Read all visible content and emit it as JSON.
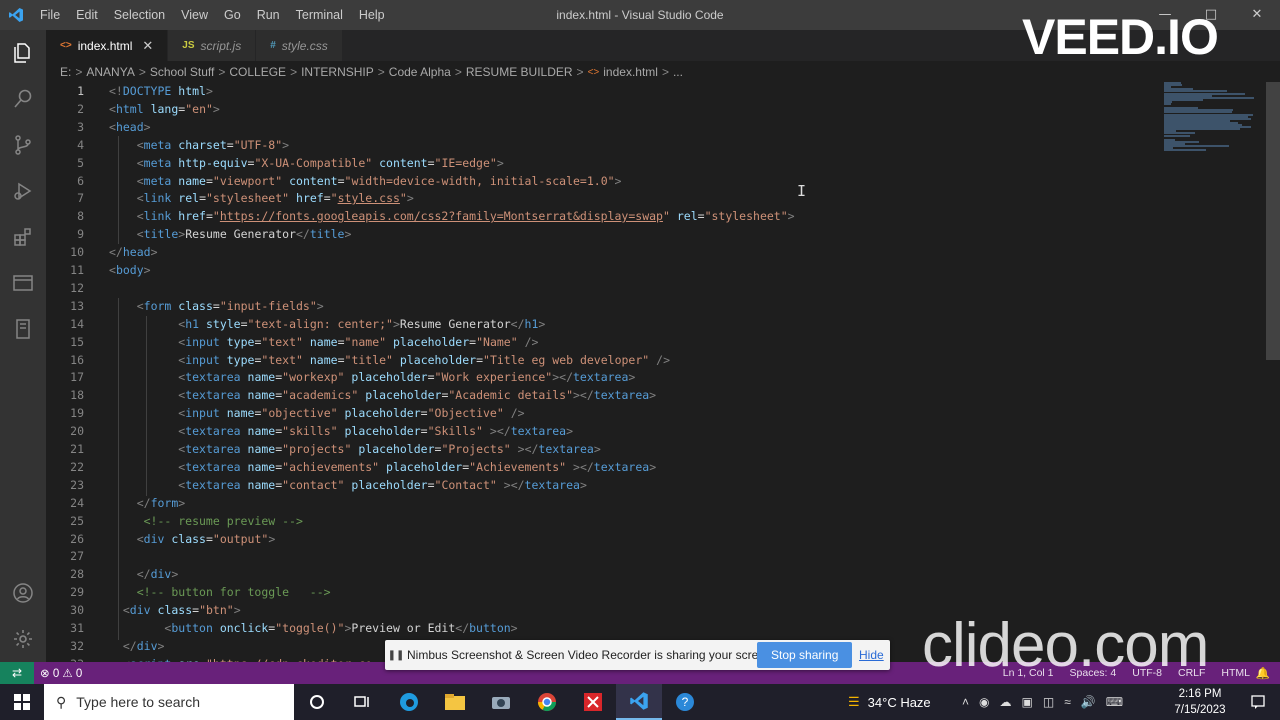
{
  "title_bar": {
    "menu": [
      "File",
      "Edit",
      "Selection",
      "View",
      "Go",
      "Run",
      "Terminal",
      "Help"
    ],
    "window_title": "index.html - Visual Studio Code"
  },
  "tabs": [
    {
      "icon": "<>",
      "label": "index.html",
      "active": true,
      "icon_color": "#e37933"
    },
    {
      "icon": "JS",
      "label": "script.js",
      "active": false,
      "icon_color": "#cbcb41"
    },
    {
      "icon": "#",
      "label": "style.css",
      "active": false,
      "icon_color": "#519aba"
    }
  ],
  "breadcrumb": [
    "E:",
    "ANANYA",
    "School Stuff",
    "COLLEGE",
    "INTERNSHIP",
    "Code Alpha",
    "RESUME BUILDER",
    "index.html",
    "..."
  ],
  "editor": {
    "current_line": 1,
    "lines": [
      [
        [
          "p",
          "<!"
        ],
        [
          "tag",
          "DOCTYPE"
        ],
        [
          "txt",
          " "
        ],
        [
          "attr",
          "html"
        ],
        [
          "p",
          ">"
        ]
      ],
      [
        [
          "p",
          "<"
        ],
        [
          "tag",
          "html"
        ],
        [
          "txt",
          " "
        ],
        [
          "attr",
          "lang"
        ],
        [
          "txt",
          "="
        ],
        [
          "str",
          "\"en\""
        ],
        [
          "p",
          ">"
        ]
      ],
      [
        [
          "p",
          "<"
        ],
        [
          "tag",
          "head"
        ],
        [
          "p",
          ">"
        ]
      ],
      [
        [
          "txt",
          "    "
        ],
        [
          "p",
          "<"
        ],
        [
          "tag",
          "meta"
        ],
        [
          "txt",
          " "
        ],
        [
          "attr",
          "charset"
        ],
        [
          "txt",
          "="
        ],
        [
          "str",
          "\"UTF-8\""
        ],
        [
          "p",
          ">"
        ]
      ],
      [
        [
          "txt",
          "    "
        ],
        [
          "p",
          "<"
        ],
        [
          "tag",
          "meta"
        ],
        [
          "txt",
          " "
        ],
        [
          "attr",
          "http-equiv"
        ],
        [
          "txt",
          "="
        ],
        [
          "str",
          "\"X-UA-Compatible\""
        ],
        [
          "txt",
          " "
        ],
        [
          "attr",
          "content"
        ],
        [
          "txt",
          "="
        ],
        [
          "str",
          "\"IE=edge\""
        ],
        [
          "p",
          ">"
        ]
      ],
      [
        [
          "txt",
          "    "
        ],
        [
          "p",
          "<"
        ],
        [
          "tag",
          "meta"
        ],
        [
          "txt",
          " "
        ],
        [
          "attr",
          "name"
        ],
        [
          "txt",
          "="
        ],
        [
          "str",
          "\"viewport\""
        ],
        [
          "txt",
          " "
        ],
        [
          "attr",
          "content"
        ],
        [
          "txt",
          "="
        ],
        [
          "str",
          "\"width=device-width, initial-scale=1.0\""
        ],
        [
          "p",
          ">"
        ]
      ],
      [
        [
          "txt",
          "    "
        ],
        [
          "p",
          "<"
        ],
        [
          "tag",
          "link"
        ],
        [
          "txt",
          " "
        ],
        [
          "attr",
          "rel"
        ],
        [
          "txt",
          "="
        ],
        [
          "str",
          "\"stylesheet\""
        ],
        [
          "txt",
          " "
        ],
        [
          "attr",
          "href"
        ],
        [
          "txt",
          "="
        ],
        [
          "str",
          "\""
        ],
        [
          "url",
          "style.css"
        ],
        [
          "str",
          "\""
        ],
        [
          "p",
          ">"
        ]
      ],
      [
        [
          "txt",
          "    "
        ],
        [
          "p",
          "<"
        ],
        [
          "tag",
          "link"
        ],
        [
          "txt",
          " "
        ],
        [
          "attr",
          "href"
        ],
        [
          "txt",
          "="
        ],
        [
          "str",
          "\""
        ],
        [
          "url",
          "https://fonts.googleapis.com/css2?family=Montserrat&display=swap"
        ],
        [
          "str",
          "\""
        ],
        [
          "txt",
          " "
        ],
        [
          "attr",
          "rel"
        ],
        [
          "txt",
          "="
        ],
        [
          "str",
          "\"stylesheet\""
        ],
        [
          "p",
          ">"
        ]
      ],
      [
        [
          "txt",
          "    "
        ],
        [
          "p",
          "<"
        ],
        [
          "tag",
          "title"
        ],
        [
          "p",
          ">"
        ],
        [
          "txt",
          "Resume Generator"
        ],
        [
          "p",
          "</"
        ],
        [
          "tag",
          "title"
        ],
        [
          "p",
          ">"
        ]
      ],
      [
        [
          "p",
          "</"
        ],
        [
          "tag",
          "head"
        ],
        [
          "p",
          ">"
        ]
      ],
      [
        [
          "p",
          "<"
        ],
        [
          "tag",
          "body"
        ],
        [
          "p",
          ">"
        ]
      ],
      [],
      [
        [
          "txt",
          "    "
        ],
        [
          "p",
          "<"
        ],
        [
          "tag",
          "form"
        ],
        [
          "txt",
          " "
        ],
        [
          "attr",
          "class"
        ],
        [
          "txt",
          "="
        ],
        [
          "str",
          "\"input-fields\""
        ],
        [
          "p",
          ">"
        ]
      ],
      [
        [
          "txt",
          "          "
        ],
        [
          "p",
          "<"
        ],
        [
          "tag",
          "h1"
        ],
        [
          "txt",
          " "
        ],
        [
          "attr",
          "style"
        ],
        [
          "txt",
          "="
        ],
        [
          "str",
          "\"text-align: center;\""
        ],
        [
          "p",
          ">"
        ],
        [
          "txt",
          "Resume Generator"
        ],
        [
          "p",
          "</"
        ],
        [
          "tag",
          "h1"
        ],
        [
          "p",
          ">"
        ]
      ],
      [
        [
          "txt",
          "          "
        ],
        [
          "p",
          "<"
        ],
        [
          "tag",
          "input"
        ],
        [
          "txt",
          " "
        ],
        [
          "attr",
          "type"
        ],
        [
          "txt",
          "="
        ],
        [
          "str",
          "\"text\""
        ],
        [
          "txt",
          " "
        ],
        [
          "attr",
          "name"
        ],
        [
          "txt",
          "="
        ],
        [
          "str",
          "\"name\""
        ],
        [
          "txt",
          " "
        ],
        [
          "attr",
          "placeholder"
        ],
        [
          "txt",
          "="
        ],
        [
          "str",
          "\"Name\""
        ],
        [
          "txt",
          " "
        ],
        [
          "p",
          "/>"
        ]
      ],
      [
        [
          "txt",
          "          "
        ],
        [
          "p",
          "<"
        ],
        [
          "tag",
          "input"
        ],
        [
          "txt",
          " "
        ],
        [
          "attr",
          "type"
        ],
        [
          "txt",
          "="
        ],
        [
          "str",
          "\"text\""
        ],
        [
          "txt",
          " "
        ],
        [
          "attr",
          "name"
        ],
        [
          "txt",
          "="
        ],
        [
          "str",
          "\"title\""
        ],
        [
          "txt",
          " "
        ],
        [
          "attr",
          "placeholder"
        ],
        [
          "txt",
          "="
        ],
        [
          "str",
          "\"Title eg web developer\""
        ],
        [
          "txt",
          " "
        ],
        [
          "p",
          "/>"
        ]
      ],
      [
        [
          "txt",
          "          "
        ],
        [
          "p",
          "<"
        ],
        [
          "tag",
          "textarea"
        ],
        [
          "txt",
          " "
        ],
        [
          "attr",
          "name"
        ],
        [
          "txt",
          "="
        ],
        [
          "str",
          "\"workexp\""
        ],
        [
          "txt",
          " "
        ],
        [
          "attr",
          "placeholder"
        ],
        [
          "txt",
          "="
        ],
        [
          "str",
          "\"Work experience\""
        ],
        [
          "p",
          "></"
        ],
        [
          "tag",
          "textarea"
        ],
        [
          "p",
          ">"
        ]
      ],
      [
        [
          "txt",
          "          "
        ],
        [
          "p",
          "<"
        ],
        [
          "tag",
          "textarea"
        ],
        [
          "txt",
          " "
        ],
        [
          "attr",
          "name"
        ],
        [
          "txt",
          "="
        ],
        [
          "str",
          "\"academics\""
        ],
        [
          "txt",
          " "
        ],
        [
          "attr",
          "placeholder"
        ],
        [
          "txt",
          "="
        ],
        [
          "str",
          "\"Academic details\""
        ],
        [
          "p",
          "></"
        ],
        [
          "tag",
          "textarea"
        ],
        [
          "p",
          ">"
        ]
      ],
      [
        [
          "txt",
          "          "
        ],
        [
          "p",
          "<"
        ],
        [
          "tag",
          "input"
        ],
        [
          "txt",
          " "
        ],
        [
          "attr",
          "name"
        ],
        [
          "txt",
          "="
        ],
        [
          "str",
          "\"objective\""
        ],
        [
          "txt",
          " "
        ],
        [
          "attr",
          "placeholder"
        ],
        [
          "txt",
          "="
        ],
        [
          "str",
          "\"Objective\""
        ],
        [
          "txt",
          " "
        ],
        [
          "p",
          "/>"
        ]
      ],
      [
        [
          "txt",
          "          "
        ],
        [
          "p",
          "<"
        ],
        [
          "tag",
          "textarea"
        ],
        [
          "txt",
          " "
        ],
        [
          "attr",
          "name"
        ],
        [
          "txt",
          "="
        ],
        [
          "str",
          "\"skills\""
        ],
        [
          "txt",
          " "
        ],
        [
          "attr",
          "placeholder"
        ],
        [
          "txt",
          "="
        ],
        [
          "str",
          "\"Skills\""
        ],
        [
          "txt",
          " "
        ],
        [
          "p",
          "></"
        ],
        [
          "tag",
          "textarea"
        ],
        [
          "p",
          ">"
        ]
      ],
      [
        [
          "txt",
          "          "
        ],
        [
          "p",
          "<"
        ],
        [
          "tag",
          "textarea"
        ],
        [
          "txt",
          " "
        ],
        [
          "attr",
          "name"
        ],
        [
          "txt",
          "="
        ],
        [
          "str",
          "\"projects\""
        ],
        [
          "txt",
          " "
        ],
        [
          "attr",
          "placeholder"
        ],
        [
          "txt",
          "="
        ],
        [
          "str",
          "\"Projects\""
        ],
        [
          "txt",
          " "
        ],
        [
          "p",
          "></"
        ],
        [
          "tag",
          "textarea"
        ],
        [
          "p",
          ">"
        ]
      ],
      [
        [
          "txt",
          "          "
        ],
        [
          "p",
          "<"
        ],
        [
          "tag",
          "textarea"
        ],
        [
          "txt",
          " "
        ],
        [
          "attr",
          "name"
        ],
        [
          "txt",
          "="
        ],
        [
          "str",
          "\"achievements\""
        ],
        [
          "txt",
          " "
        ],
        [
          "attr",
          "placeholder"
        ],
        [
          "txt",
          "="
        ],
        [
          "str",
          "\"Achievements\""
        ],
        [
          "txt",
          " "
        ],
        [
          "p",
          "></"
        ],
        [
          "tag",
          "textarea"
        ],
        [
          "p",
          ">"
        ]
      ],
      [
        [
          "txt",
          "          "
        ],
        [
          "p",
          "<"
        ],
        [
          "tag",
          "textarea"
        ],
        [
          "txt",
          " "
        ],
        [
          "attr",
          "name"
        ],
        [
          "txt",
          "="
        ],
        [
          "str",
          "\"contact\""
        ],
        [
          "txt",
          " "
        ],
        [
          "attr",
          "placeholder"
        ],
        [
          "txt",
          "="
        ],
        [
          "str",
          "\"Contact\""
        ],
        [
          "txt",
          " "
        ],
        [
          "p",
          "></"
        ],
        [
          "tag",
          "textarea"
        ],
        [
          "p",
          ">"
        ]
      ],
      [
        [
          "txt",
          "    "
        ],
        [
          "p",
          "</"
        ],
        [
          "tag",
          "form"
        ],
        [
          "p",
          ">"
        ]
      ],
      [
        [
          "txt",
          "     "
        ],
        [
          "com",
          "<!-- resume preview -->"
        ]
      ],
      [
        [
          "txt",
          "    "
        ],
        [
          "p",
          "<"
        ],
        [
          "tag",
          "div"
        ],
        [
          "txt",
          " "
        ],
        [
          "attr",
          "class"
        ],
        [
          "txt",
          "="
        ],
        [
          "str",
          "\"output\""
        ],
        [
          "p",
          ">"
        ]
      ],
      [],
      [
        [
          "txt",
          "    "
        ],
        [
          "p",
          "</"
        ],
        [
          "tag",
          "div"
        ],
        [
          "p",
          ">"
        ]
      ],
      [
        [
          "txt",
          "    "
        ],
        [
          "com",
          "<!-- button for toggle   -->"
        ]
      ],
      [
        [
          "txt",
          "  "
        ],
        [
          "p",
          "<"
        ],
        [
          "tag",
          "div"
        ],
        [
          "txt",
          " "
        ],
        [
          "attr",
          "class"
        ],
        [
          "txt",
          "="
        ],
        [
          "str",
          "\"btn\""
        ],
        [
          "p",
          ">"
        ]
      ],
      [
        [
          "txt",
          "        "
        ],
        [
          "p",
          "<"
        ],
        [
          "tag",
          "button"
        ],
        [
          "txt",
          " "
        ],
        [
          "attr",
          "onclick"
        ],
        [
          "txt",
          "="
        ],
        [
          "str",
          "\"toggle()\""
        ],
        [
          "p",
          ">"
        ],
        [
          "txt",
          "Preview or Edit"
        ],
        [
          "p",
          "</"
        ],
        [
          "tag",
          "button"
        ],
        [
          "p",
          ">"
        ]
      ],
      [
        [
          "txt",
          "  "
        ],
        [
          "p",
          "</"
        ],
        [
          "tag",
          "div"
        ],
        [
          "p",
          ">"
        ]
      ],
      [
        [
          "txt",
          "  "
        ],
        [
          "p",
          "<"
        ],
        [
          "tag",
          "script"
        ],
        [
          "txt",
          " "
        ],
        [
          "attr",
          "src"
        ],
        [
          "txt",
          "="
        ],
        [
          "str",
          "\"https://cdn.ckeditor.co"
        ]
      ]
    ]
  },
  "status_bar": {
    "problems": "⊗ 0 ⚠ 0",
    "right_items": [
      "Ln 1, Col 1",
      "Spaces: 4",
      "UTF-8",
      "CRLF",
      "HTML"
    ]
  },
  "share_bar": {
    "message": "Nimbus Screenshot & Screen Video Recorder is sharing your screen.",
    "stop_label": "Stop sharing",
    "hide_label": "Hide"
  },
  "taskbar": {
    "search_placeholder": "Type here to search",
    "weather": "34°C  Haze",
    "time": "2:16 PM",
    "date": "7/15/2023"
  },
  "watermarks": {
    "top": "VEED.IO",
    "bottom": "clideo.com"
  },
  "colors": {
    "status_bar": "#68217a",
    "remote": "#16825d",
    "share_button": "#4a90e2"
  }
}
